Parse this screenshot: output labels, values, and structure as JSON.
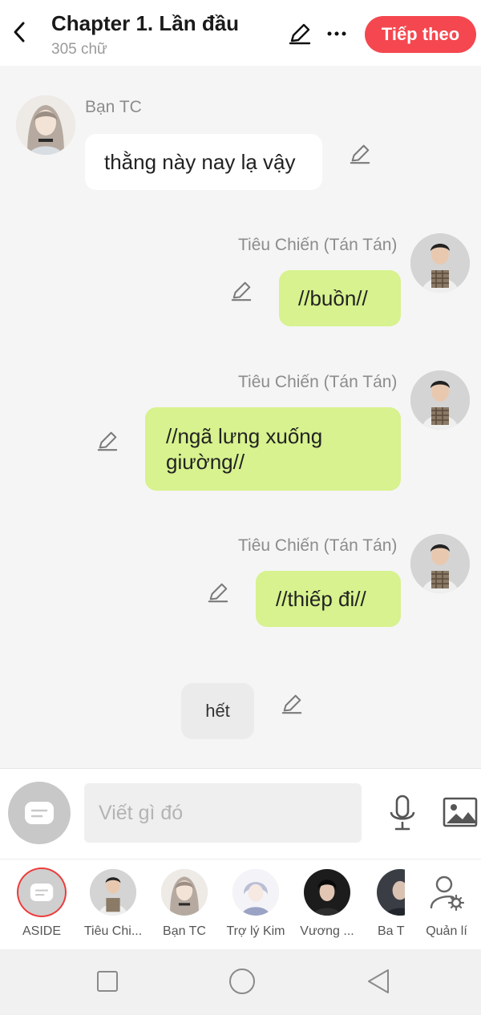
{
  "header": {
    "title": "Chapter 1. Lần đầu",
    "word_count": "305 chữ",
    "next_label": "Tiếp theo",
    "next_color": "#f5474f"
  },
  "messages": [
    {
      "speaker": "Bạn TC",
      "text": "thằng này nay lạ vậy",
      "side": "left",
      "avatar": "girl-avatar"
    },
    {
      "speaker": "Tiêu Chiến (Tán Tán)",
      "text": "//buồn//",
      "side": "right",
      "avatar": "boy-avatar"
    },
    {
      "speaker": "Tiêu Chiến (Tán Tán)",
      "text_line1": "//ngã lưng xuống",
      "text_line2": "giường//",
      "side": "right",
      "avatar": "boy-avatar"
    },
    {
      "speaker": "Tiêu Chiến (Tán Tán)",
      "text": "//thiếp đi//",
      "side": "right",
      "avatar": "boy-avatar"
    },
    {
      "text": "hết",
      "side": "narration"
    }
  ],
  "composer": {
    "placeholder": "Viết gì đó",
    "icons": [
      "aside-icon",
      "microphone-icon",
      "image-icon"
    ]
  },
  "characters": [
    {
      "name": "ASIDE",
      "selected": true
    },
    {
      "name": "Tiêu Chi..."
    },
    {
      "name": "Bạn TC"
    },
    {
      "name": "Trợ lý Kim"
    },
    {
      "name": "Vương ..."
    },
    {
      "name": "Ba T"
    },
    {
      "name": "Quản lí"
    }
  ],
  "colors": {
    "right_bubble": "#d7f28e",
    "left_bubble": "#ffffff",
    "background": "#f5f5f5"
  }
}
